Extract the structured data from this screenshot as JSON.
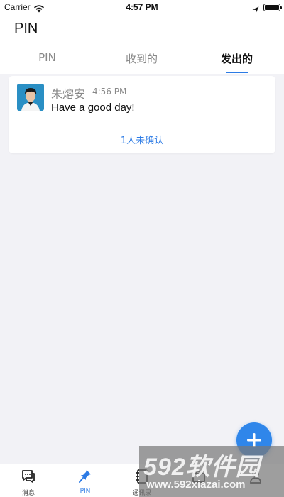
{
  "status_bar": {
    "carrier": "Carrier",
    "time": "4:57 PM",
    "battery_level": 1.0
  },
  "header": {
    "title": "PIN"
  },
  "tabs": [
    {
      "label": "PIN",
      "active": false
    },
    {
      "label": "收到的",
      "active": false
    },
    {
      "label": "发出的",
      "active": true
    }
  ],
  "pins": [
    {
      "sender": "朱熔安",
      "time": "4:56 PM",
      "message": "Have a good day!",
      "unconfirmed": "1人未确认"
    }
  ],
  "fab": {
    "icon": "plus-icon"
  },
  "tabbar": {
    "items": [
      {
        "label": "消息",
        "icon": "chat-icon",
        "active": false
      },
      {
        "label": "PIN",
        "icon": "pin-icon",
        "active": true
      },
      {
        "label": "通讯录",
        "icon": "contacts-icon",
        "active": false
      },
      {
        "label": "",
        "icon": "briefcase-icon",
        "active": false
      },
      {
        "label": "",
        "icon": "profile-icon",
        "active": false
      }
    ]
  },
  "watermark": {
    "brand": "592软件园",
    "url": "www.592xiazai.com"
  },
  "colors": {
    "accent": "#2c7be5",
    "fab": "#2f86ea",
    "background": "#f2f2f6"
  }
}
